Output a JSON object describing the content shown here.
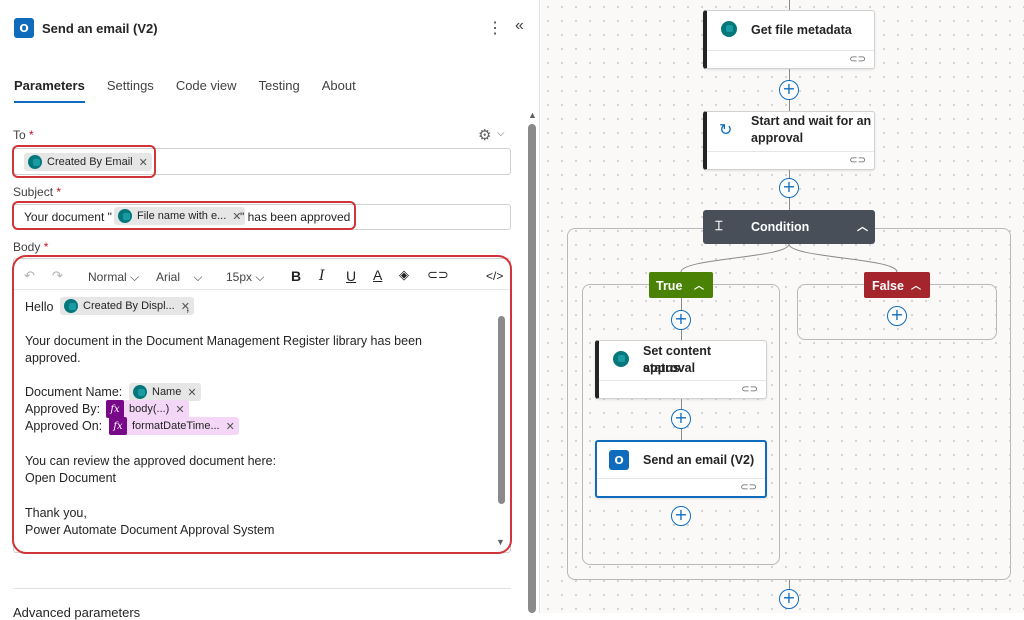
{
  "panel": {
    "title": "Send an email (V2)",
    "more_icon": "⋮",
    "collapse_icon": "«",
    "tabs": [
      "Parameters",
      "Settings",
      "Code view",
      "Testing",
      "About"
    ],
    "to": {
      "label": "To",
      "required": "*",
      "token": "Created By Email"
    },
    "subject": {
      "label": "Subject",
      "required": "*",
      "prefix": "Your document \"",
      "token": "File name with e...",
      "suffix": "\" has been approved"
    },
    "body": {
      "label": "Body",
      "required": "*",
      "toolbar": {
        "format": "Normal",
        "font": "Arial",
        "size": "15px",
        "bold": "B",
        "italic": "I",
        "underline": "U",
        "code": "</>"
      },
      "hello": "Hello",
      "hello_token": "Created By Displ...",
      "hello_comma": ",",
      "line1": "Your document in the Document Management Register library has been",
      "line2": "approved.",
      "doc_name_label": "Document Name:",
      "doc_name_token": "Name",
      "approved_by_label": "Approved By:",
      "approved_by_token": "body(...)",
      "approved_on_label": "Approved On:",
      "approved_on_token": "formatDateTime...",
      "review_line": "You can review the approved document here:",
      "open_doc": "Open Document",
      "thanks": "Thank you,",
      "signature": "Power Automate Document Approval System"
    },
    "advanced": "Advanced parameters"
  },
  "flow": {
    "get_metadata": "Get file metadata",
    "start_wait": "Start and wait for an",
    "start_wait2": "approval",
    "condition": "Condition",
    "true_label": "True",
    "false_label": "False",
    "set_content": "Set content approval",
    "set_content2": "status",
    "send_email": "Send an email (V2)"
  },
  "colors": {
    "accent": "#0f6cbd",
    "true": "#498205",
    "false": "#a4262c",
    "condition": "#484f58",
    "highlight": "#d13438"
  }
}
